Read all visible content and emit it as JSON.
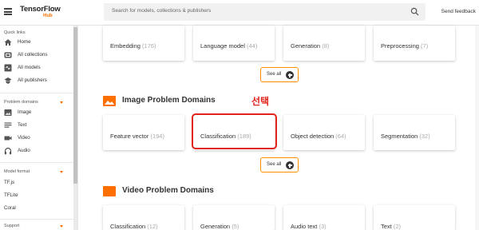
{
  "header": {
    "logo_main": "TensorFlow",
    "logo_sub": "Hub",
    "search_placeholder": "Search for models, collections & publishers",
    "send_feedback": "Send feedback"
  },
  "sidebar": {
    "quick_links_heading": "Quick links",
    "quick_links": [
      {
        "label": "Home",
        "icon": "home-icon"
      },
      {
        "label": "All collections",
        "icon": "collections-icon"
      },
      {
        "label": "All models",
        "icon": "models-icon"
      },
      {
        "label": "All publishers",
        "icon": "publishers-icon"
      }
    ],
    "problem_domains_heading": "Problem domains",
    "problem_domains": [
      {
        "label": "Image",
        "icon": "image-icon"
      },
      {
        "label": "Text",
        "icon": "text-icon"
      },
      {
        "label": "Video",
        "icon": "video-icon"
      },
      {
        "label": "Audio",
        "icon": "audio-icon"
      }
    ],
    "model_format_heading": "Model format",
    "model_formats": [
      "TF.js",
      "TFLite",
      "Coral"
    ],
    "support_heading": "Support"
  },
  "top_cards": [
    {
      "label": "Embedding",
      "count": "(176)"
    },
    {
      "label": "Language model",
      "count": "(44)"
    },
    {
      "label": "Generation",
      "count": "(8)"
    },
    {
      "label": "Preprocessing",
      "count": "(7)"
    }
  ],
  "see_all_label": "See all",
  "image_section": {
    "title": "Image Problem Domains",
    "cards": [
      {
        "label": "Feature vector",
        "count": "(194)"
      },
      {
        "label": "Classification",
        "count": "(189)"
      },
      {
        "label": "Object detection",
        "count": "(64)"
      },
      {
        "label": "Segmentation",
        "count": "(32)"
      }
    ]
  },
  "video_section": {
    "title": "Video Problem Domains",
    "cards": [
      {
        "label": "Classification",
        "count": "(12)"
      },
      {
        "label": "Generation",
        "count": "(5)"
      },
      {
        "label": "Audio text",
        "count": "(3)"
      },
      {
        "label": "Text",
        "count": "(2)"
      }
    ]
  },
  "annotation": {
    "label": "선택",
    "color": "#e2231a"
  },
  "colors": {
    "accent": "#ff6f00",
    "annotation": "#e2231a"
  }
}
